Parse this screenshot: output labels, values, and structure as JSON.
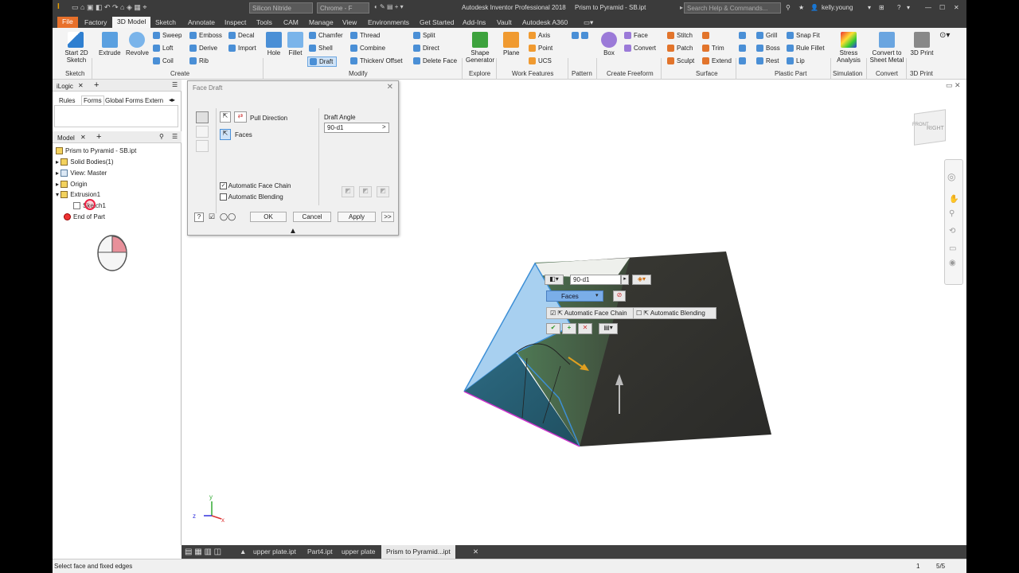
{
  "app_title": "Autodesk Inventor Professional 2018",
  "doc_title": "Prism to Pyramid - SB.ipt",
  "material": "Silicon Nitride",
  "appearance": "Chrome - F",
  "search_placeholder": "Search Help & Commands...",
  "user": "kelly.young",
  "ribbon_tabs": [
    "File",
    "Factory",
    "3D Model",
    "Sketch",
    "Annotate",
    "Inspect",
    "Tools",
    "CAM",
    "Manage",
    "View",
    "Environments",
    "Get Started",
    "Add-Ins",
    "Vault",
    "Autodesk A360"
  ],
  "ribbon": {
    "start_sketch": "Start 2D Sketch",
    "extrude": "Extrude",
    "revolve": "Revolve",
    "sweep": "Sweep",
    "loft": "Loft",
    "coil": "Coil",
    "emboss": "Emboss",
    "derive": "Derive",
    "rib": "Rib",
    "decal": "Decal",
    "import": "Import",
    "hole": "Hole",
    "fillet": "Fillet",
    "chamfer": "Chamfer",
    "shell": "Shell",
    "draft": "Draft",
    "thread": "Thread",
    "combine": "Combine",
    "thicken": "Thicken/ Offset",
    "split": "Split",
    "direct": "Direct",
    "delete_face": "Delete Face",
    "shape_generator": "Shape Generator",
    "plane": "Plane",
    "axis": "Axis",
    "point": "Point",
    "ucs": "UCS",
    "box": "Box",
    "face": "Face",
    "convert": "Convert",
    "stitch": "Stitch",
    "patch": "Patch",
    "sculpt": "Sculpt",
    "trim": "Trim",
    "extend": "Extend",
    "grill": "Grill",
    "boss": "Boss",
    "rest": "Rest",
    "snap_fit": "Snap Fit",
    "rule_fillet": "Rule Fillet",
    "lip": "Lip",
    "stress_analysis": "Stress Analysis",
    "convert_sheet_metal": "Convert to Sheet Metal",
    "print3d": "3D Print",
    "groups": {
      "sketch": "Sketch",
      "create": "Create",
      "modify": "Modify",
      "explore": "Explore",
      "work_features": "Work Features",
      "pattern": "Pattern",
      "create_freeform": "Create Freeform",
      "surface": "Surface",
      "plastic_part": "Plastic Part",
      "simulation": "Simulation",
      "convert": "Convert",
      "print3d": "3D Print"
    }
  },
  "ilogic": {
    "title": "iLogic",
    "tabs": [
      "Rules",
      "Forms",
      "Global Forms",
      "Extern"
    ]
  },
  "model": {
    "title": "Model",
    "tree": [
      "Prism to Pyramid - SB.ipt",
      "Solid Bodies(1)",
      "View: Master",
      "Origin",
      "Extrusion1",
      "Sketch1",
      "End of Part"
    ]
  },
  "dialog": {
    "title": "Face Draft",
    "pull_direction": "Pull Direction",
    "faces": "Faces",
    "draft_angle_label": "Draft Angle",
    "draft_angle_value": "90-d1",
    "automatic_face_chain": "Automatic Face Chain",
    "automatic_blending": "Automatic Blending",
    "ok": "OK",
    "cancel": "Cancel",
    "apply": "Apply",
    "more": ">>"
  },
  "mini_toolbar": {
    "value": "90-d1",
    "faces": "Faces",
    "automatic_face_chain": "Automatic Face Chain",
    "automatic_blending": "Automatic Blending"
  },
  "viewcube": {
    "right": "RIGHT",
    "front": "FRONT"
  },
  "doc_tabs": [
    "upper plate.ipt",
    "Part4.ipt",
    "upper plate",
    "Prism to Pyramid...ipt"
  ],
  "status": {
    "prompt": "Select face and fixed edges",
    "count": "1",
    "pages": "5/5"
  },
  "axes": {
    "z": "z",
    "y": "y",
    "x": "x"
  },
  "colors": {
    "accent": "#e8702a",
    "dark_bar": "#3b3b3b",
    "highlight": "#9fc8f0"
  }
}
